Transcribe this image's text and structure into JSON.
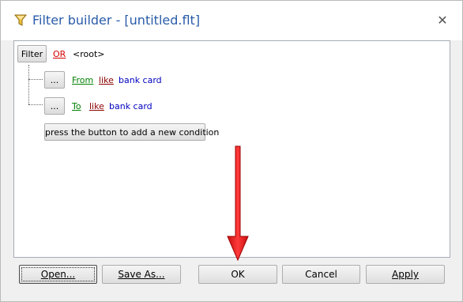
{
  "window": {
    "title": "Filter builder - [untitled.flt]",
    "close_symbol": "✕"
  },
  "filter": {
    "filter_button": "Filter",
    "group_operator": "OR",
    "root_label": "<root>",
    "conditions": [
      {
        "ellipsis": "...",
        "field": "From",
        "operator": "like",
        "value": "bank card"
      },
      {
        "ellipsis": "...",
        "field": "To",
        "operator": "like",
        "value": "bank card"
      }
    ],
    "add_condition_label": "press the button to add a new condition"
  },
  "buttons": {
    "open": "Open...",
    "save_as": "Save As...",
    "ok": "OK",
    "cancel": "Cancel",
    "apply": "Apply"
  },
  "colors": {
    "title": "#2a5caa",
    "group_operator": "#d40000",
    "field": "#008000",
    "operator": "#8b0000",
    "value": "#0000c0",
    "arrow": "#e51a1a"
  }
}
